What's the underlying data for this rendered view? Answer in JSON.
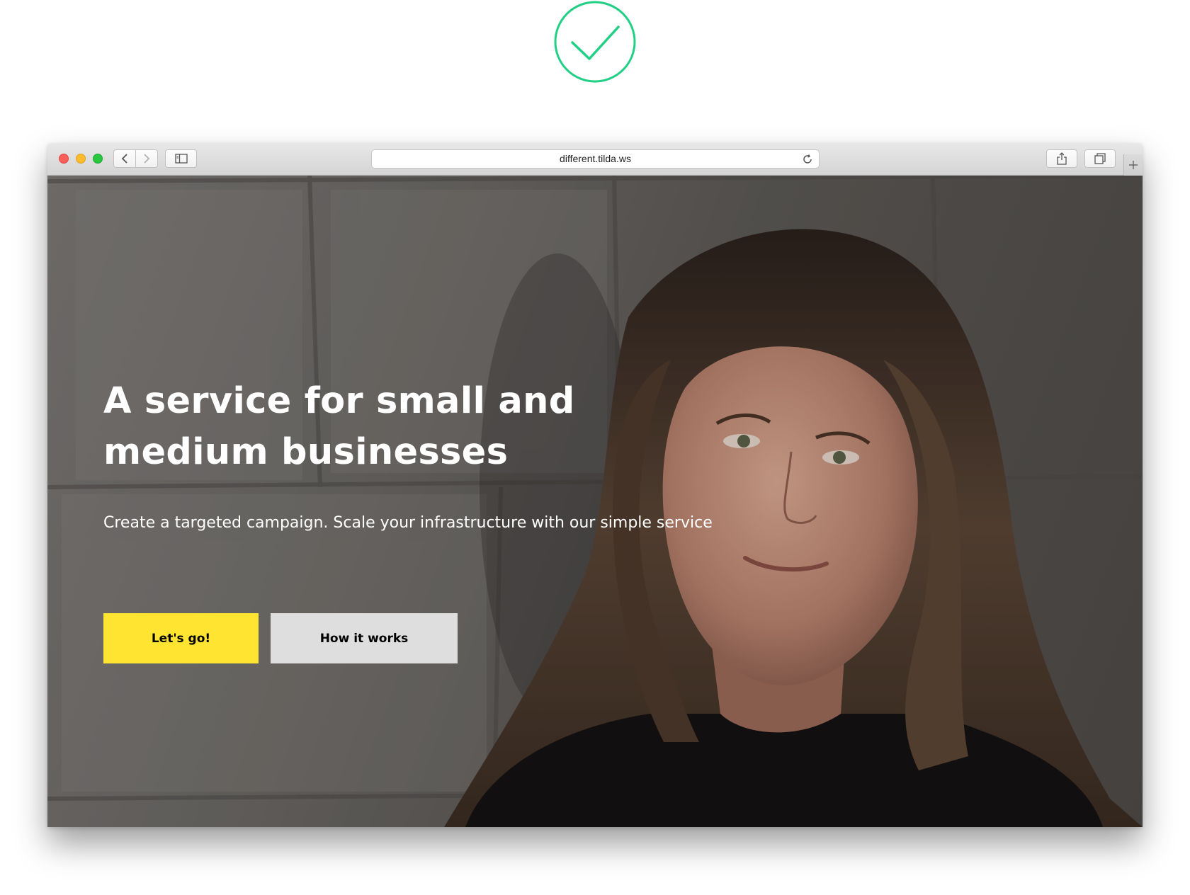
{
  "colors": {
    "check_badge": "#21d084",
    "primary_button": "#ffe431",
    "secondary_button": "#dedede",
    "hero_text": "#ffffff"
  },
  "badge": {
    "icon": "checkmark-circle-icon"
  },
  "browser": {
    "url": "different.tilda.ws",
    "icons": [
      "back-arrow-icon",
      "forward-arrow-icon",
      "sidebar-icon",
      "reload-icon",
      "share-icon",
      "tabs-icon",
      "plus-icon"
    ]
  },
  "hero": {
    "title": "A service for small and medium businesses",
    "subtitle": "Create a targeted campaign. Scale your infrastructure with our simple service",
    "primary_button": "Let's go!",
    "secondary_button": "How it works"
  }
}
